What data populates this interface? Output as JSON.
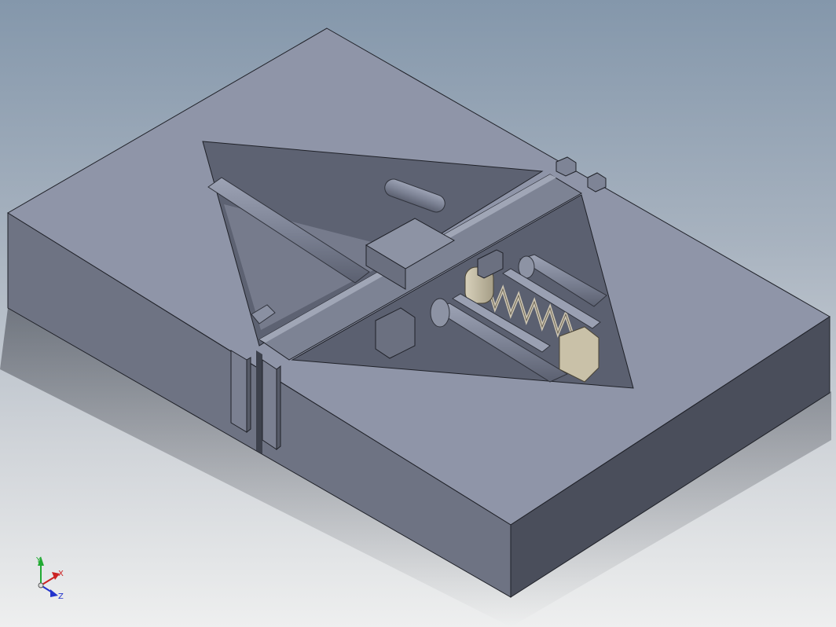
{
  "viewport": {
    "name": "3D model view",
    "background_top": "#8497ab",
    "background_bottom": "#eeefef"
  },
  "model": {
    "description_colors": {
      "top_face": "#8f95a8",
      "left_face": "#6b7080",
      "front_face": "#4b4f5c",
      "spring": "#c8c0ae",
      "plunger": "#c6bea5"
    }
  },
  "triad": {
    "x_label": "X",
    "y_label": "Y",
    "z_label": "Z",
    "x_color": "#cc2222",
    "y_color": "#22aa33",
    "z_color": "#2233cc"
  }
}
